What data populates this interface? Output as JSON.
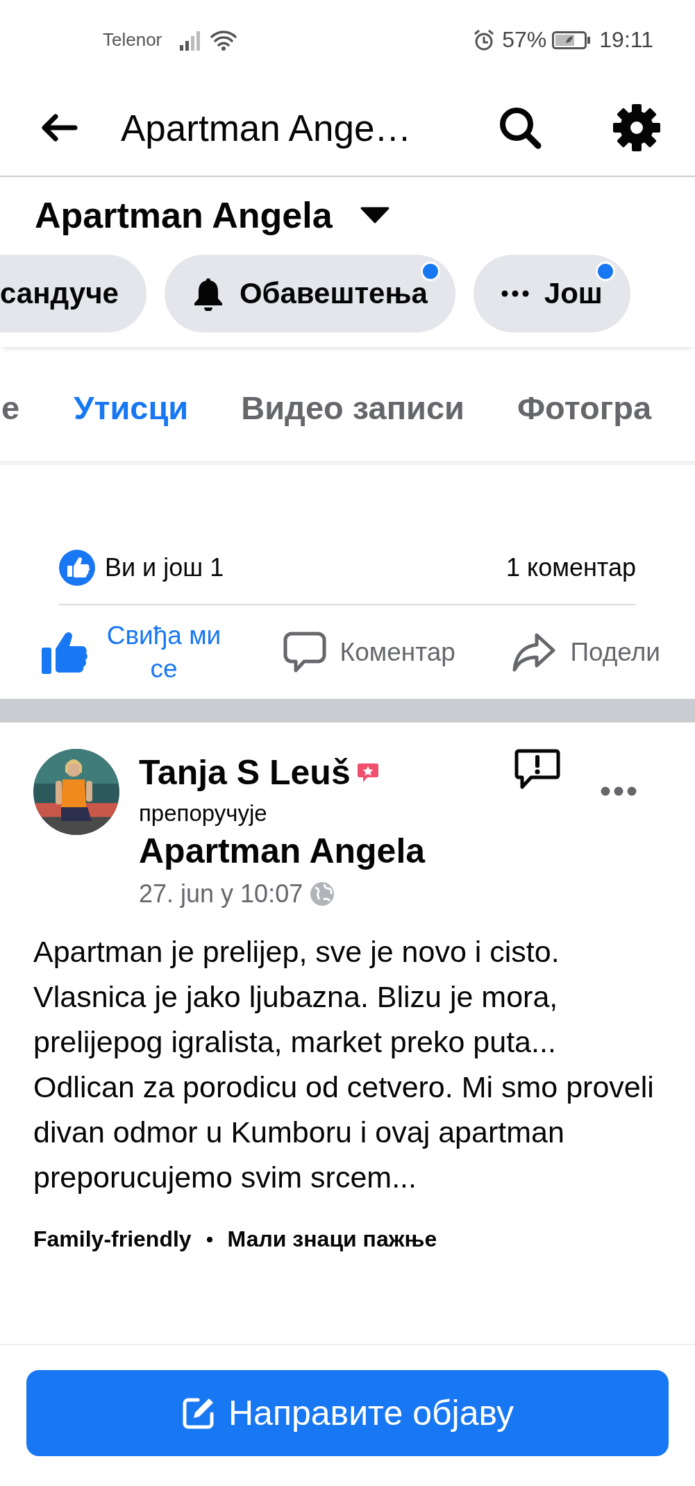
{
  "status_bar": {
    "carrier": "Telenor",
    "battery": "57%",
    "time": "19:11"
  },
  "header": {
    "title": "Apartman Ange…"
  },
  "page": {
    "name": "Apartman Angela"
  },
  "chips": [
    {
      "label": "сандуче",
      "kind": "plain",
      "has_notification": false
    },
    {
      "label": "Обавештења",
      "kind": "bell",
      "has_notification": true
    },
    {
      "label": "Још",
      "kind": "more",
      "has_notification": true
    }
  ],
  "tabs": [
    {
      "label": "е",
      "selected": false
    },
    {
      "label": "Утисци",
      "selected": true
    },
    {
      "label": "Видео записи",
      "selected": false
    },
    {
      "label": "Фотогра",
      "selected": false
    }
  ],
  "post": {
    "reactions": "Ви и још 1",
    "comments": "1 коментар",
    "actions": [
      {
        "label": "Свиђа ми се",
        "kind": "like",
        "selected": true
      },
      {
        "label": "Коментар",
        "kind": "comment",
        "selected": false
      },
      {
        "label": "Подели",
        "kind": "share",
        "selected": false
      }
    ]
  },
  "review": {
    "author": "Tanja S Leuš",
    "verb": "препоручује",
    "page": "Apartman Angela",
    "date": "27. jun у 10:07",
    "text": "Apartman je prelijep, sve je novo i cisto. Vlasnica je jako ljubazna. Blizu je mora, prelijepog igralista, market preko puta... Odlican za porodicu od cetvero. Mi smo proveli divan odmor u Kumboru i ovaj apartman preporucujemo svim srcem...",
    "tags": [
      "Family-friendly",
      "Мали знаци пажње"
    ]
  },
  "create_button": {
    "label": "Направите објаву"
  }
}
